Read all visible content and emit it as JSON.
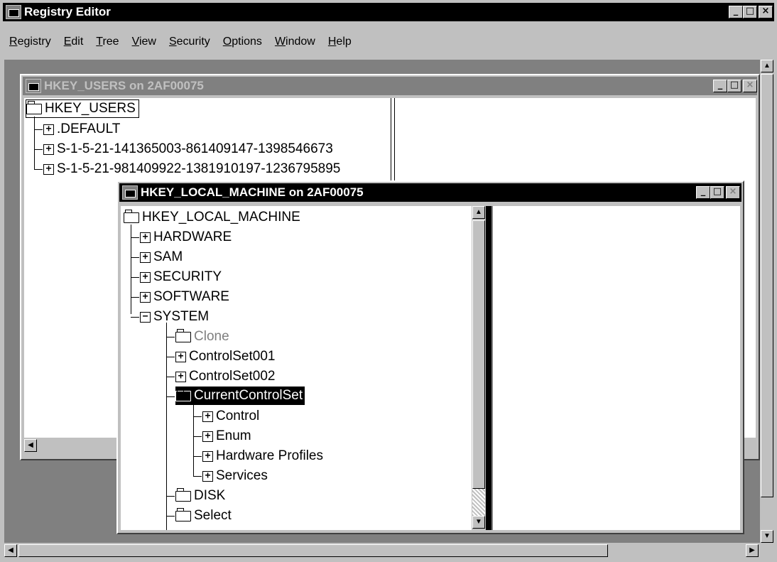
{
  "app": {
    "title": "Registry Editor",
    "menu": [
      {
        "label": "Registry",
        "accel": "R",
        "rest": "egistry"
      },
      {
        "label": "Edit",
        "accel": "E",
        "rest": "dit"
      },
      {
        "label": "Tree",
        "accel": "T",
        "rest": "ree"
      },
      {
        "label": "View",
        "accel": "V",
        "rest": "iew"
      },
      {
        "label": "Security",
        "accel": "S",
        "rest": "ecurity"
      },
      {
        "label": "Options",
        "accel": "O",
        "rest": "ptions"
      },
      {
        "label": "Window",
        "accel": "W",
        "rest": "indow"
      },
      {
        "label": "Help",
        "accel": "H",
        "rest": "elp"
      }
    ],
    "controls": {
      "minimize": "_",
      "maximize": "□",
      "close": "×"
    }
  },
  "users_window": {
    "title": "HKEY_USERS on 2AF00075",
    "root": "HKEY_USERS",
    "children": [
      ".DEFAULT",
      "S-1-5-21-141365003-861409147-1398546673",
      "S-1-5-21-981409922-1381910197-1236795895"
    ]
  },
  "hklm_window": {
    "title": "HKEY_LOCAL_MACHINE on 2AF00075",
    "root": "HKEY_LOCAL_MACHINE",
    "level1": [
      "HARDWARE",
      "SAM",
      "SECURITY",
      "SOFTWARE",
      "SYSTEM"
    ],
    "system_children": [
      "Clone",
      "ControlSet001",
      "ControlSet002",
      "CurrentControlSet",
      "DISK",
      "Select"
    ],
    "ccs_children": [
      "Control",
      "Enum",
      "Hardware Profiles",
      "Services"
    ]
  },
  "icons": {
    "expand": "+",
    "collapse": "−",
    "arrow_up": "▲",
    "arrow_down": "▼",
    "arrow_left": "◀",
    "arrow_right": "▶"
  },
  "colors": {
    "titlebar_active": "#000000",
    "titlebar_inactive": "#808080",
    "face": "#c0c0c0",
    "workspace": "#808080",
    "selection": "#000000"
  }
}
